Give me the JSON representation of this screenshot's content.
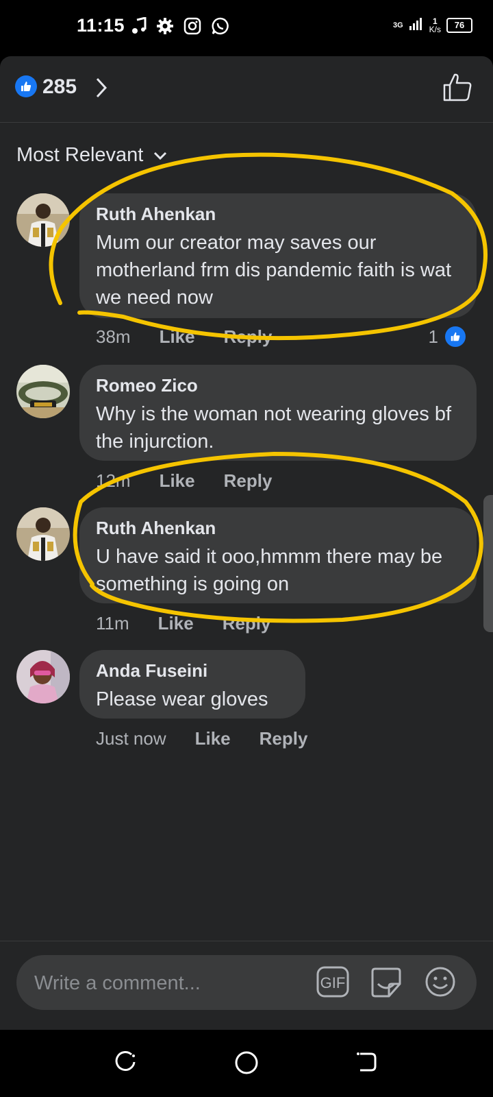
{
  "status_bar": {
    "time": "11:15",
    "network": "3G",
    "speed_value": "1",
    "speed_unit": "K/s",
    "battery": "76",
    "icons": [
      "music-note-icon",
      "gear-icon",
      "instagram-icon",
      "whatsapp-icon",
      "signal-icon",
      "battery-icon"
    ]
  },
  "reactions": {
    "count": "285"
  },
  "sort": {
    "label": "Most Relevant"
  },
  "comments": [
    {
      "author": "Ruth Ahenkan",
      "text": "Mum our creator may saves our motherland frm dis pandemic faith is wat we need now",
      "time": "38m",
      "like_label": "Like",
      "reply_label": "Reply",
      "reaction_count": "1"
    },
    {
      "author": "Romeo Zico",
      "text": "Why is the woman not wearing gloves bf the injurction.",
      "time": "12m",
      "like_label": "Like",
      "reply_label": "Reply"
    },
    {
      "author": "Ruth Ahenkan",
      "text": "U have said it ooo,hmmm there may be something is going on",
      "time": "11m",
      "like_label": "Like",
      "reply_label": "Reply"
    },
    {
      "author": "Anda Fuseini",
      "text": "Please wear gloves",
      "time": "Just now",
      "like_label": "Like",
      "reply_label": "Reply"
    }
  ],
  "composer": {
    "placeholder": "Write a comment...",
    "gif_label": "GIF"
  },
  "colors": {
    "panel_bg": "#242526",
    "bubble_bg": "#3a3b3c",
    "accent": "#1877f2",
    "annotation": "#f5c400"
  }
}
